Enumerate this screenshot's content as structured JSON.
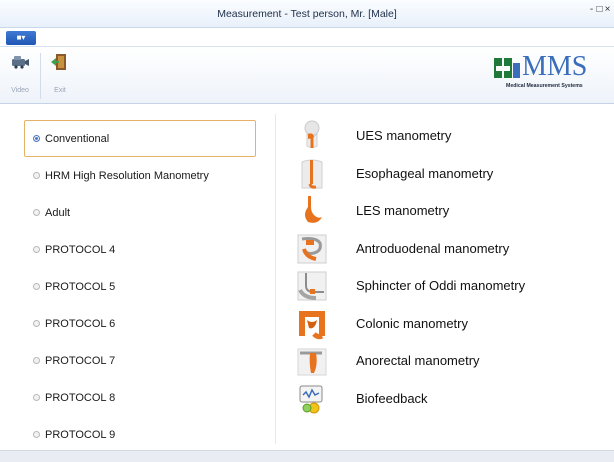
{
  "window": {
    "title": "Measurement - Test person, Mr. [Male]",
    "controls": [
      "-",
      "□",
      "×"
    ]
  },
  "app_menu": {
    "label": "■▾"
  },
  "ribbon": {
    "buttons": [
      {
        "label": "Video",
        "icon": "video-camera-icon"
      },
      {
        "label": "Exit",
        "icon": "exit-door-icon"
      }
    ]
  },
  "logo": {
    "brand": "MMS",
    "subtitle": "Medical Measurement Systems"
  },
  "protocols": {
    "selected_index": 0,
    "items": [
      "Conventional",
      "HRM High Resolution Manometry",
      "Adult",
      "PROTOCOL 4",
      "PROTOCOL 5",
      "PROTOCOL 6",
      "PROTOCOL 7",
      "PROTOCOL 8",
      "PROTOCOL 9"
    ]
  },
  "tests": [
    {
      "label": "UES manometry",
      "icon": "throat-icon"
    },
    {
      "label": "Esophageal manometry",
      "icon": "esophagus-icon"
    },
    {
      "label": "LES manometry",
      "icon": "stomach-icon"
    },
    {
      "label": "Antroduodenal manometry",
      "icon": "duodenum-icon"
    },
    {
      "label": "Sphincter of Oddi manometry",
      "icon": "biliary-icon"
    },
    {
      "label": "Colonic manometry",
      "icon": "colon-icon"
    },
    {
      "label": "Anorectal manometry",
      "icon": "rectum-icon"
    },
    {
      "label": "Biofeedback",
      "icon": "biofeedback-icon"
    }
  ],
  "colors": {
    "accent_blue": "#3a6dba",
    "organ_orange": "#e8731f",
    "selection_border": "#e6b26a"
  }
}
